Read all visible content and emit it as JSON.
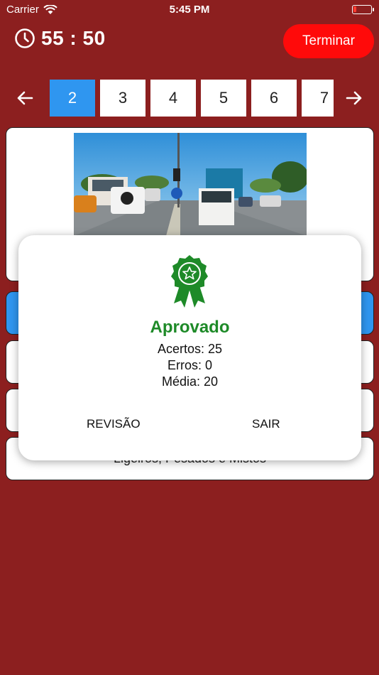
{
  "status_bar": {
    "carrier": "Carrier",
    "time": "5:45 PM",
    "battery_color": "#ff3b30"
  },
  "header": {
    "timer": "55 : 50",
    "timer_icon": "clock-icon",
    "finish_label": "Terminar"
  },
  "pager": {
    "prev_icon": "arrow-left-icon",
    "next_icon": "arrow-right-icon",
    "pages": [
      "2",
      "3",
      "4",
      "5",
      "6",
      "7"
    ],
    "active": "2"
  },
  "question": {
    "image": "road-traffic-photo"
  },
  "options": {
    "visible_text": "Ligeiros, Pesados e Mistos"
  },
  "result": {
    "icon": "award-ribbon-icon",
    "title": "Aprovado",
    "hits": "Acertos: 25",
    "errors": "Erros: 0",
    "average": "Média: 20",
    "review_label": "REVISÃO",
    "exit_label": "SAIR"
  },
  "colors": {
    "background": "#8c1f1f",
    "finish_button": "#ff0a0a",
    "active_page": "#2f96f0",
    "approved_green": "#1e8a28"
  }
}
